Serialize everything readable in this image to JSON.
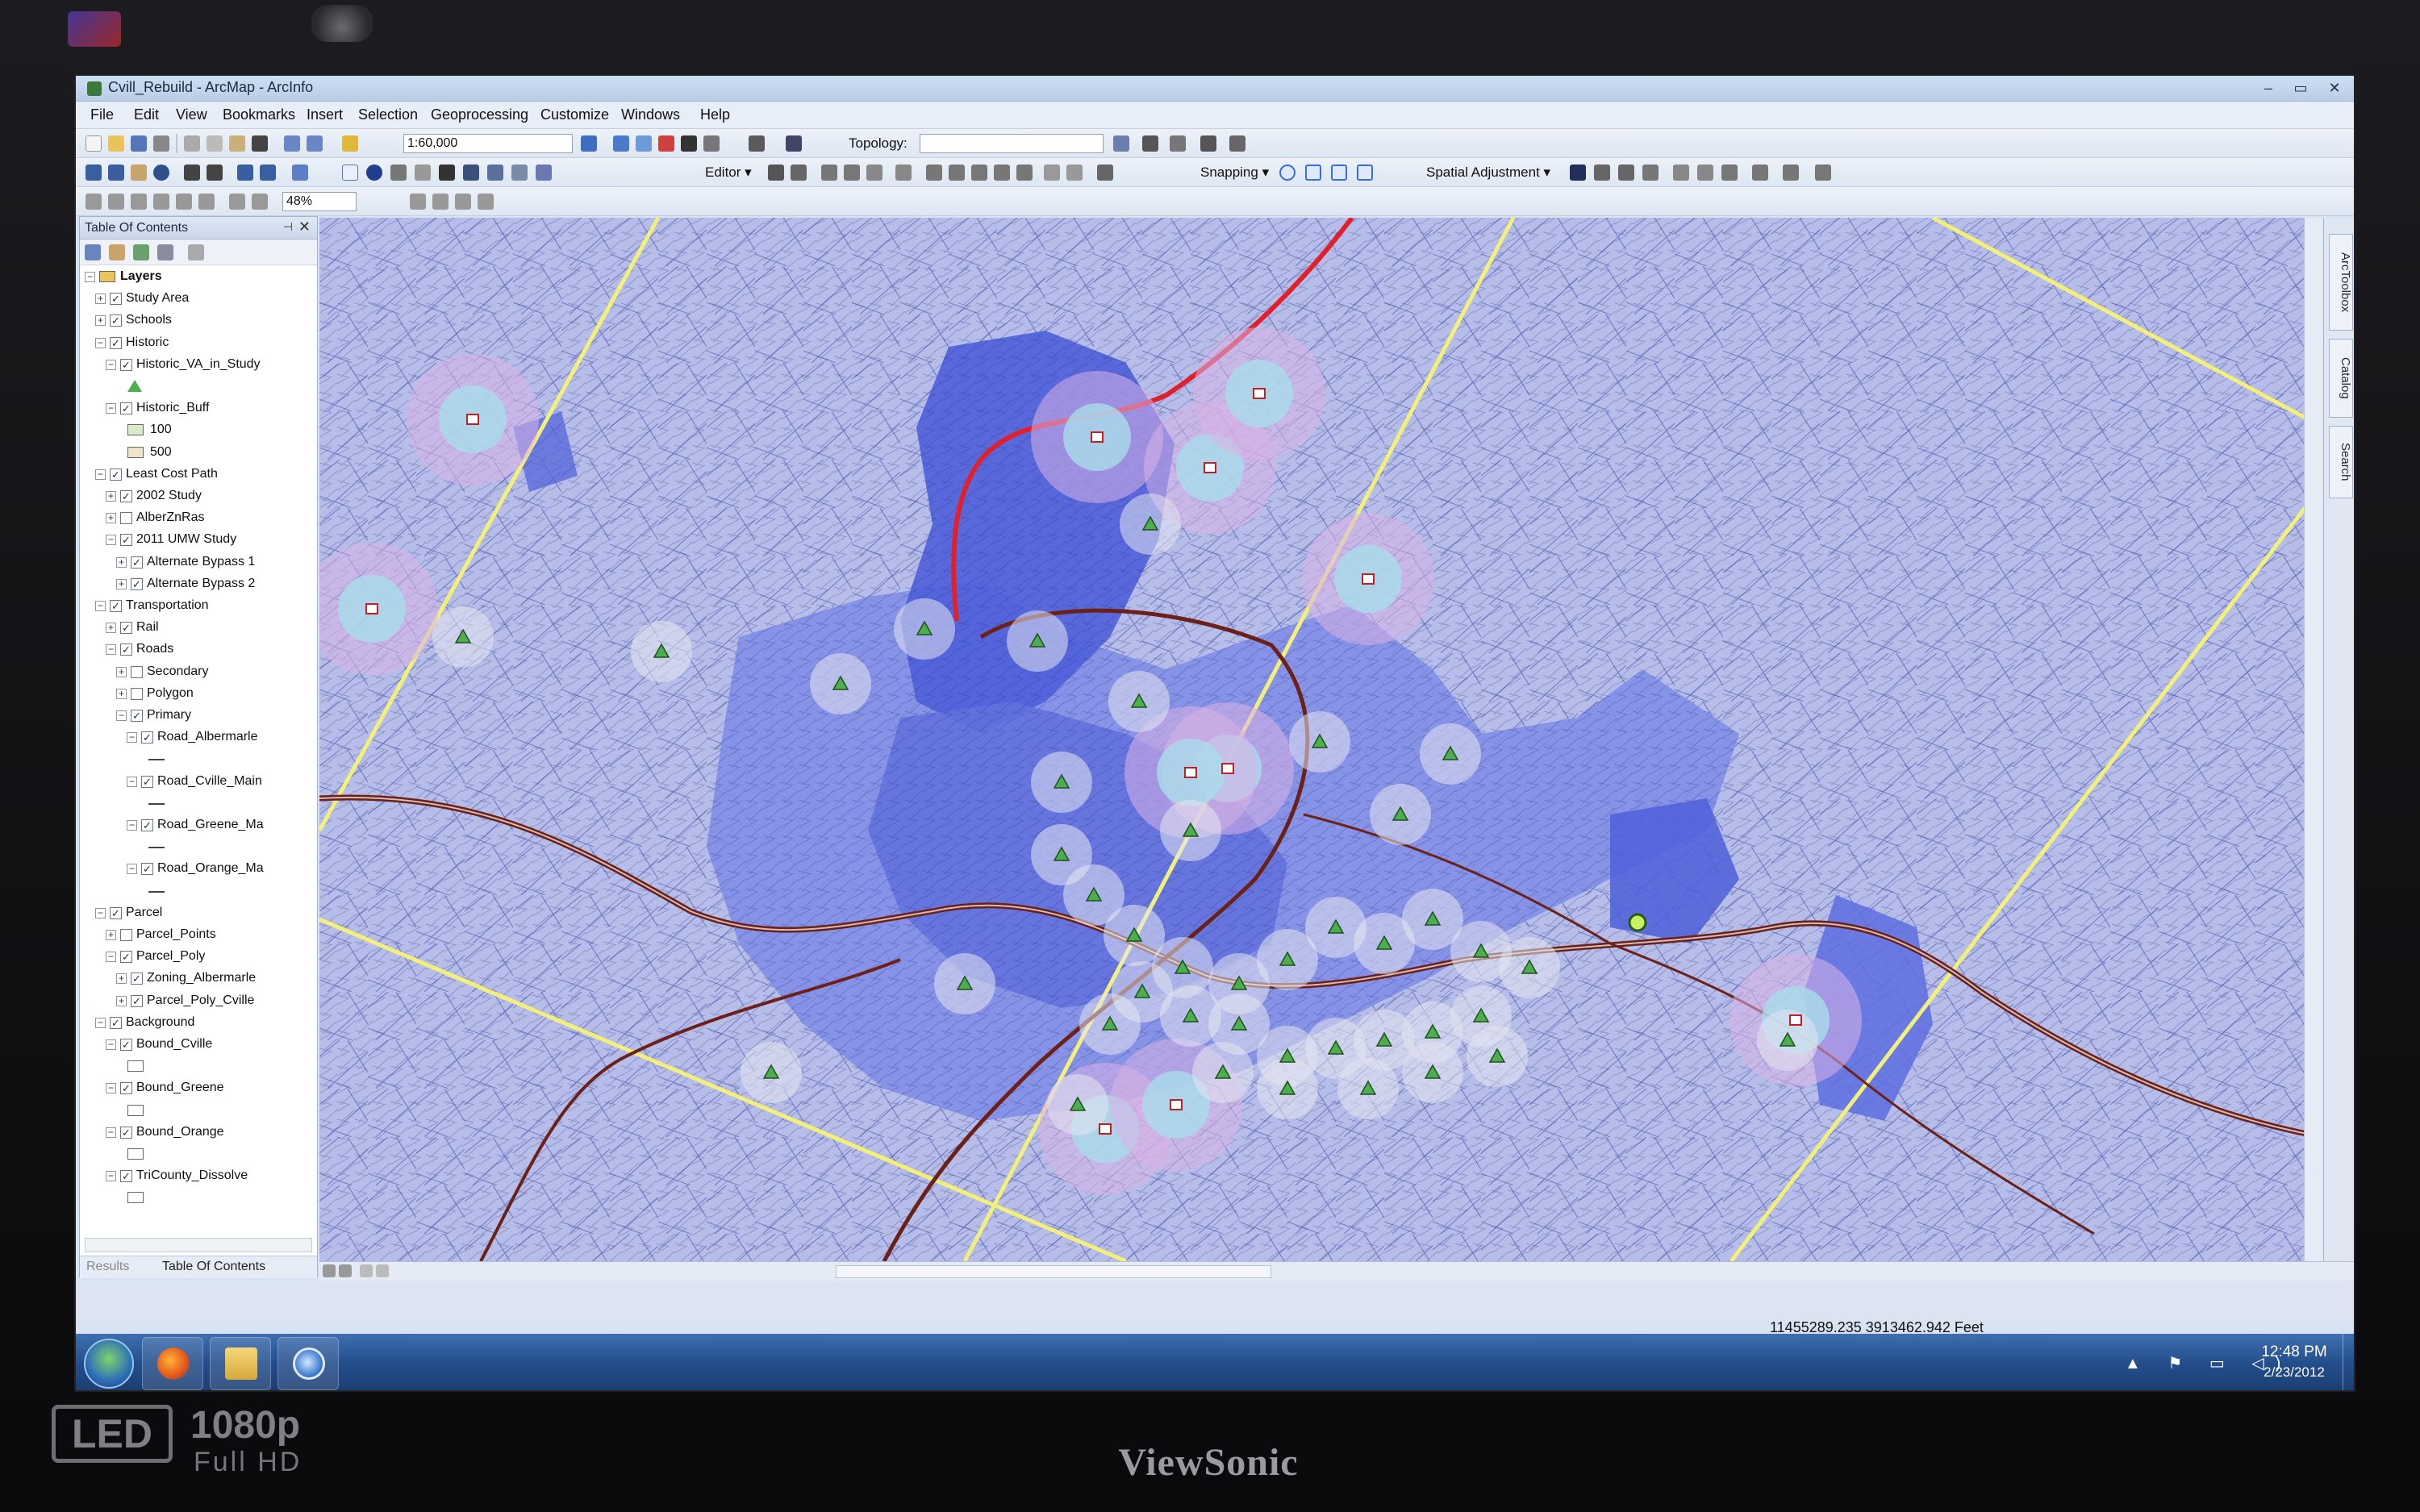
{
  "window": {
    "title": "Cvill_Rebuild - ArcMap - ArcInfo",
    "controls": [
      "–",
      "▭",
      "✕"
    ]
  },
  "menu": [
    "File",
    "Edit",
    "View",
    "Bookmarks",
    "Insert",
    "Selection",
    "Geoprocessing",
    "Customize",
    "Windows",
    "Help"
  ],
  "toolbar": {
    "scale": "1:60,000",
    "topology_label": "Topology:",
    "topology_value": "",
    "editor_label": "Editor ▾",
    "snapping_label": "Snapping ▾",
    "spatial_adjustment_label": "Spatial Adjustment ▾",
    "zoom": "48%"
  },
  "toc": {
    "title": "Table Of Contents",
    "pin": "⊣",
    "close": "✕",
    "layers": [
      {
        "label": "Layers",
        "level": 0,
        "expander": "−",
        "checked": null,
        "bold": true
      },
      {
        "label": "Study Area",
        "level": 1,
        "expander": "+",
        "checked": true
      },
      {
        "label": "Schools",
        "level": 1,
        "expander": "+",
        "checked": true
      },
      {
        "label": "Historic",
        "level": 1,
        "expander": "−",
        "checked": true
      },
      {
        "label": "Historic_VA_in_Study",
        "level": 2,
        "expander": "−",
        "checked": true
      },
      {
        "label": "",
        "level": 3,
        "symbol": "triangle"
      },
      {
        "label": "Historic_Buff",
        "level": 2,
        "expander": "−",
        "checked": true
      },
      {
        "label": "100",
        "level": 3,
        "symbol": "patch",
        "color": "#d9ecc9"
      },
      {
        "label": "500",
        "level": 3,
        "symbol": "patch",
        "color": "#f0e4c8"
      },
      {
        "label": "Least Cost Path",
        "level": 1,
        "expander": "−",
        "checked": true
      },
      {
        "label": "2002 Study",
        "level": 2,
        "expander": "+",
        "checked": true
      },
      {
        "label": "AlberZnRas",
        "level": 2,
        "expander": "+",
        "checked": false
      },
      {
        "label": "2011 UMW Study",
        "level": 2,
        "expander": "−",
        "checked": true
      },
      {
        "label": "Alternate Bypass 1",
        "level": 3,
        "expander": "+",
        "checked": true
      },
      {
        "label": "Alternate Bypass 2",
        "level": 3,
        "expander": "+",
        "checked": true
      },
      {
        "label": "Transportation",
        "level": 1,
        "expander": "−",
        "checked": true
      },
      {
        "label": "Rail",
        "level": 2,
        "expander": "+",
        "checked": true
      },
      {
        "label": "Roads",
        "level": 2,
        "expander": "−",
        "checked": true
      },
      {
        "label": "Secondary",
        "level": 3,
        "expander": "+",
        "checked": false
      },
      {
        "label": "Polygon",
        "level": 3,
        "expander": "+",
        "checked": false
      },
      {
        "label": "Primary",
        "level": 3,
        "expander": "−",
        "checked": true
      },
      {
        "label": "Road_Albermarle",
        "level": 4,
        "expander": "−",
        "checked": true
      },
      {
        "label": "",
        "level": 5,
        "symbol": "line"
      },
      {
        "label": "Road_Cville_Main",
        "level": 4,
        "expander": "−",
        "checked": true
      },
      {
        "label": "",
        "level": 5,
        "symbol": "line"
      },
      {
        "label": "Road_Greene_Ma",
        "level": 4,
        "expander": "−",
        "checked": true
      },
      {
        "label": "",
        "level": 5,
        "symbol": "line"
      },
      {
        "label": "Road_Orange_Ma",
        "level": 4,
        "expander": "−",
        "checked": true
      },
      {
        "label": "",
        "level": 5,
        "symbol": "line"
      },
      {
        "label": "Parcel",
        "level": 1,
        "expander": "−",
        "checked": true
      },
      {
        "label": "Parcel_Points",
        "level": 2,
        "expander": "+",
        "checked": false
      },
      {
        "label": "Parcel_Poly",
        "level": 2,
        "expander": "−",
        "checked": true
      },
      {
        "label": "Zoning_Albermarle",
        "level": 3,
        "expander": "+",
        "checked": true
      },
      {
        "label": "Parcel_Poly_Cville",
        "level": 3,
        "expander": "+",
        "checked": true
      },
      {
        "label": "Background",
        "level": 1,
        "expander": "−",
        "checked": true
      },
      {
        "label": "Bound_Cville",
        "level": 2,
        "expander": "−",
        "checked": true
      },
      {
        "label": "",
        "level": 3,
        "symbol": "patch",
        "color": "#ffffff"
      },
      {
        "label": "Bound_Greene",
        "level": 2,
        "expander": "−",
        "checked": true
      },
      {
        "label": "",
        "level": 3,
        "symbol": "patch",
        "color": "#ffffff"
      },
      {
        "label": "Bound_Orange",
        "level": 2,
        "expander": "−",
        "checked": true
      },
      {
        "label": "",
        "level": 3,
        "symbol": "patch",
        "color": "#ffffff"
      },
      {
        "label": "TriCounty_Dissolve",
        "level": 2,
        "expander": "−",
        "checked": true
      },
      {
        "label": "",
        "level": 3,
        "symbol": "patch",
        "color": "#ffffff"
      }
    ],
    "tabs": [
      "Results",
      "Table Of Contents"
    ]
  },
  "right_dock": [
    "ArcToolbox",
    "Catalog",
    "Search"
  ],
  "status": {
    "coordinates": "11455289.235  3913462.942 Feet"
  },
  "taskbar": {
    "apps": [
      "firefox-icon",
      "folder-icon",
      "magnifier-icon"
    ],
    "tray_icons": "▲ ⚑ ▭ ◁)",
    "time": "12:48 PM",
    "date": "2/23/2012"
  },
  "monitor": {
    "brand": "ViewSonic",
    "led": "LED",
    "resolution": "1080p",
    "resolution_sub": "Full HD"
  },
  "colors": {
    "map_base": "#b6bde9",
    "map_dark": "#4f5fd9",
    "map_mid": "#7f8ce6",
    "study_area_line": "#f2f07a",
    "bypass_line": "#e0202a",
    "rail_line": "#6b2018",
    "buffer_500": "#d9b3e6",
    "buffer_100": "#a9dceb",
    "historic_symbol": "#4cae4c"
  }
}
